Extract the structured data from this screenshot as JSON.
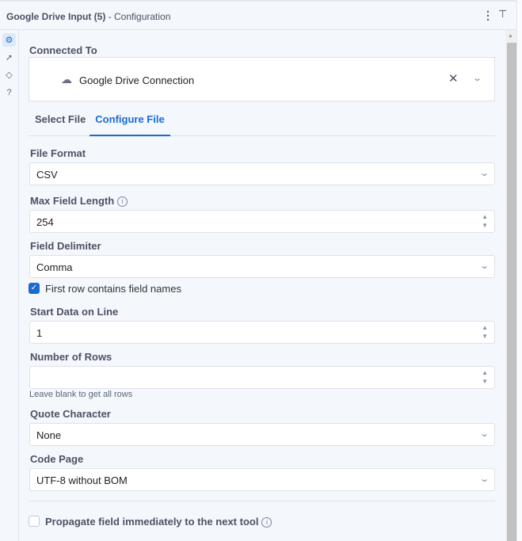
{
  "header": {
    "tool_name": "Google Drive Input (5)",
    "suffix": "- Configuration"
  },
  "connection": {
    "label": "Connected To",
    "value": "Google Drive Connection"
  },
  "tabs": [
    {
      "label": "Select File"
    },
    {
      "label": "Configure File",
      "active": true
    }
  ],
  "fields": {
    "file_format": {
      "label": "File Format",
      "value": "CSV"
    },
    "max_field_length": {
      "label": "Max Field Length",
      "value": "254"
    },
    "field_delimiter": {
      "label": "Field Delimiter",
      "value": "Comma"
    },
    "first_row": {
      "label": "First row contains field names",
      "checked": true
    },
    "start_line": {
      "label": "Start Data on Line",
      "value": "1"
    },
    "num_rows": {
      "label": "Number of Rows",
      "value": "",
      "hint": "Leave blank to get all rows"
    },
    "quote_char": {
      "label": "Quote Character",
      "value": "None"
    },
    "code_page": {
      "label": "Code Page",
      "value": "UTF-8 without BOM"
    },
    "propagate": {
      "label": "Propagate field immediately to the next tool",
      "checked": false
    }
  },
  "colors": {
    "accent": "#1a6bd1"
  }
}
